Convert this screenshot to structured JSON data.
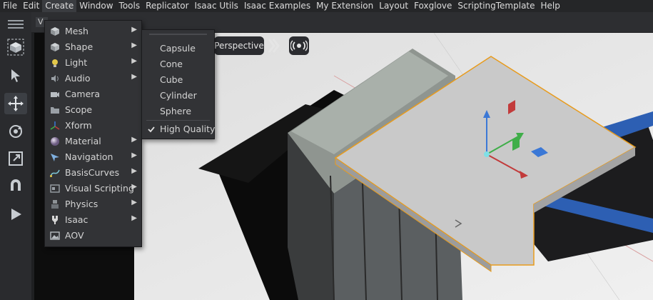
{
  "menubar": [
    "File",
    "Edit",
    "Create",
    "Window",
    "Tools",
    "Replicator",
    "Isaac Utils",
    "Isaac Examples",
    "My Extension",
    "Layout",
    "Foxglove",
    "ScriptingTemplate",
    "Help"
  ],
  "active_menu": "Create",
  "viewport": {
    "tab_label": "V",
    "camera_label": "Perspective"
  },
  "create_menu": {
    "items": [
      {
        "label": "Mesh",
        "icon": "mesh-icon",
        "submenu": true
      },
      {
        "label": "Shape",
        "icon": "shape-icon",
        "submenu": true
      },
      {
        "label": "Light",
        "icon": "light-icon",
        "submenu": true
      },
      {
        "label": "Audio",
        "icon": "audio-icon",
        "submenu": true
      },
      {
        "label": "Camera",
        "icon": "camera-icon",
        "submenu": false
      },
      {
        "label": "Scope",
        "icon": "scope-icon",
        "submenu": false
      },
      {
        "label": "Xform",
        "icon": "xform-icon",
        "submenu": false
      },
      {
        "label": "Material",
        "icon": "material-icon",
        "submenu": true
      },
      {
        "label": "Navigation",
        "icon": "navigation-icon",
        "submenu": true
      },
      {
        "label": "BasisCurves",
        "icon": "basis-curves-icon",
        "submenu": true
      },
      {
        "label": "Visual Scripting",
        "icon": "visual-scripting-icon",
        "submenu": true
      },
      {
        "label": "Physics",
        "icon": "physics-icon",
        "submenu": true
      },
      {
        "label": "Isaac",
        "icon": "isaac-icon",
        "submenu": true
      },
      {
        "label": "AOV",
        "icon": "aov-icon",
        "submenu": false
      }
    ]
  },
  "shape_submenu": {
    "items": [
      "Capsule",
      "Cone",
      "Cube",
      "Cylinder",
      "Sphere"
    ],
    "toggle": {
      "label": "High Quality",
      "checked": true
    }
  },
  "colors": {
    "accent": "#e89b1c",
    "menu_bg": "#323336",
    "x_axis": "#c23b3b",
    "y_axis": "#3fae49",
    "z_axis": "#3b78d6"
  }
}
